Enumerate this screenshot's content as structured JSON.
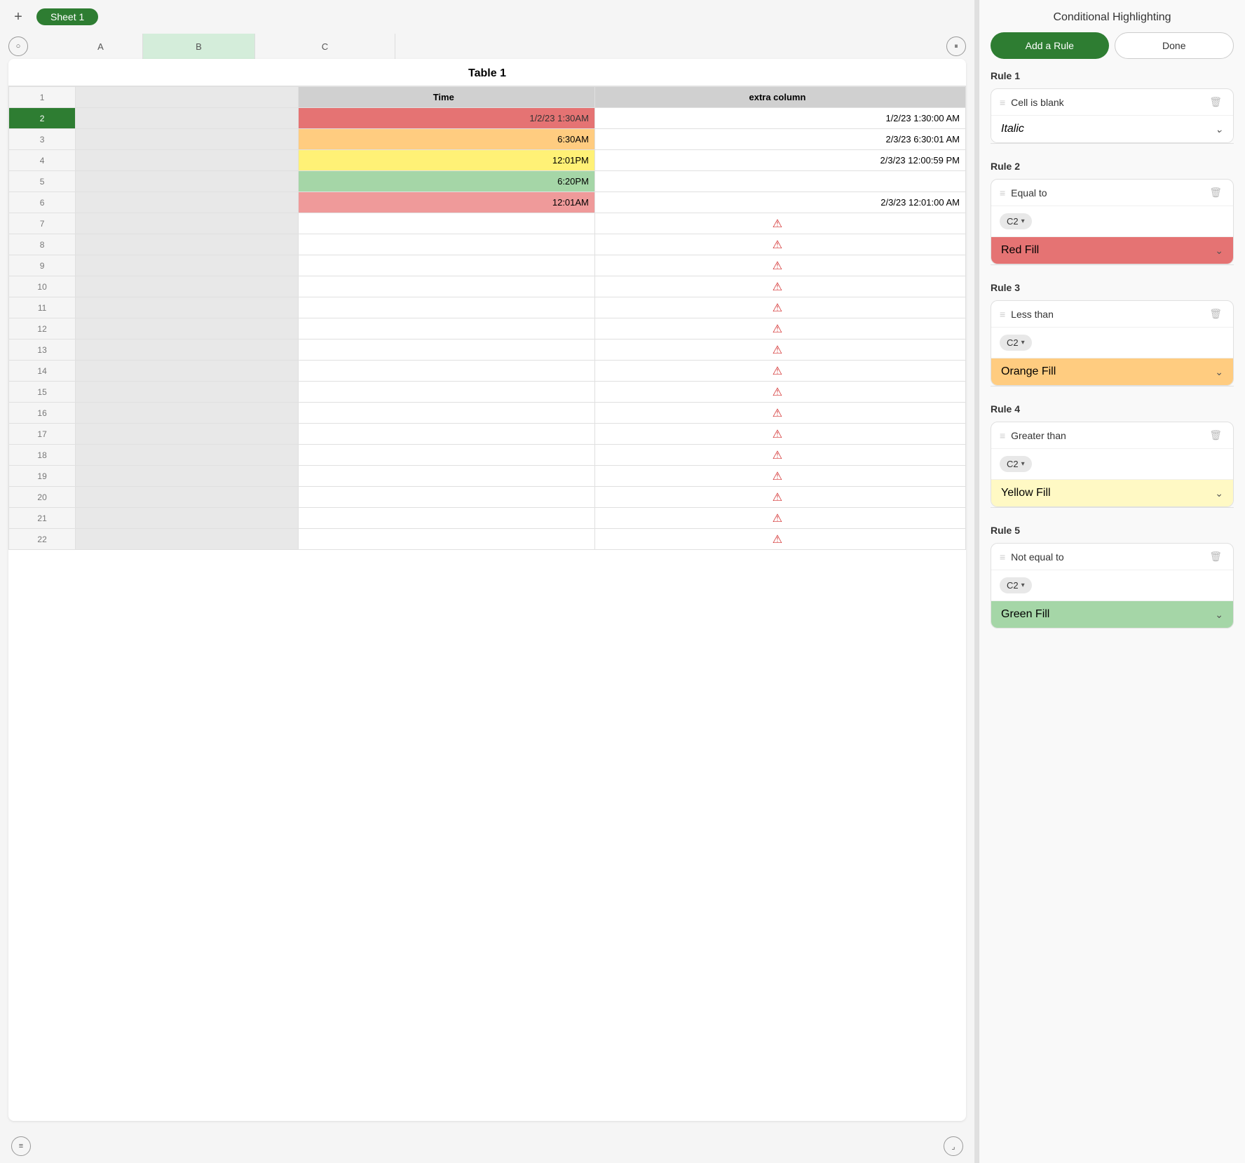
{
  "app": {
    "sheet_tab": "Sheet 1",
    "table_title": "Table 1"
  },
  "columns": {
    "a": "A",
    "b": "B",
    "c": "C",
    "b_header": "Time",
    "c_header": "extra column"
  },
  "rows": [
    {
      "num": 1,
      "a": "",
      "b": "Time",
      "c": "extra column",
      "is_header": true
    },
    {
      "num": 2,
      "a": "",
      "b": "1/2/23 1:30AM",
      "c": "1/2/23 1:30:00 AM",
      "b_style": "red",
      "selected": true
    },
    {
      "num": 3,
      "a": "",
      "b": "6:30AM",
      "c": "2/3/23 6:30:01 AM",
      "b_style": "orange"
    },
    {
      "num": 4,
      "a": "",
      "b": "12:01PM",
      "c": "2/3/23 12:00:59 PM",
      "b_style": "yellow"
    },
    {
      "num": 5,
      "a": "",
      "b": "6:20PM",
      "c": "",
      "b_style": "green"
    },
    {
      "num": 6,
      "a": "",
      "b": "12:01AM",
      "c": "2/3/23 12:01:00 AM",
      "b_style": "red-light"
    },
    {
      "num": 7,
      "a": "",
      "b": "",
      "c": "warning"
    },
    {
      "num": 8,
      "a": "",
      "b": "",
      "c": "warning"
    },
    {
      "num": 9,
      "a": "",
      "b": "",
      "c": "warning"
    },
    {
      "num": 10,
      "a": "",
      "b": "",
      "c": "warning"
    },
    {
      "num": 11,
      "a": "",
      "b": "",
      "c": "warning"
    },
    {
      "num": 12,
      "a": "",
      "b": "",
      "c": "warning"
    },
    {
      "num": 13,
      "a": "",
      "b": "",
      "c": "warning"
    },
    {
      "num": 14,
      "a": "",
      "b": "",
      "c": "warning"
    },
    {
      "num": 15,
      "a": "",
      "b": "",
      "c": "warning"
    },
    {
      "num": 16,
      "a": "",
      "b": "",
      "c": "warning"
    },
    {
      "num": 17,
      "a": "",
      "b": "",
      "c": "warning"
    },
    {
      "num": 18,
      "a": "",
      "b": "",
      "c": "warning"
    },
    {
      "num": 19,
      "a": "",
      "b": "",
      "c": "warning"
    },
    {
      "num": 20,
      "a": "",
      "b": "",
      "c": "warning"
    },
    {
      "num": 21,
      "a": "",
      "b": "",
      "c": "warning"
    },
    {
      "num": 22,
      "a": "",
      "b": "",
      "c": "warning"
    }
  ],
  "panel": {
    "title": "Conditional Highlighting",
    "add_rule_label": "Add a Rule",
    "done_label": "Done"
  },
  "rules": [
    {
      "id": 1,
      "label": "Rule 1",
      "condition": "Cell is blank",
      "style": "Italic",
      "style_class": "fill-italic",
      "has_cell_ref": false
    },
    {
      "id": 2,
      "label": "Rule 2",
      "condition": "Equal to",
      "cell_ref": "C2",
      "style": "Red Fill",
      "style_class": "fill-red"
    },
    {
      "id": 3,
      "label": "Rule 3",
      "condition": "Less than",
      "cell_ref": "C2",
      "style": "Orange Fill",
      "style_class": "fill-orange"
    },
    {
      "id": 4,
      "label": "Rule 4",
      "condition": "Greater than",
      "cell_ref": "C2",
      "style": "Yellow Fill",
      "style_class": "fill-yellow"
    },
    {
      "id": 5,
      "label": "Rule 5",
      "condition": "Not equal to",
      "cell_ref": "C2",
      "style": "Green Fill",
      "style_class": "fill-green"
    }
  ]
}
